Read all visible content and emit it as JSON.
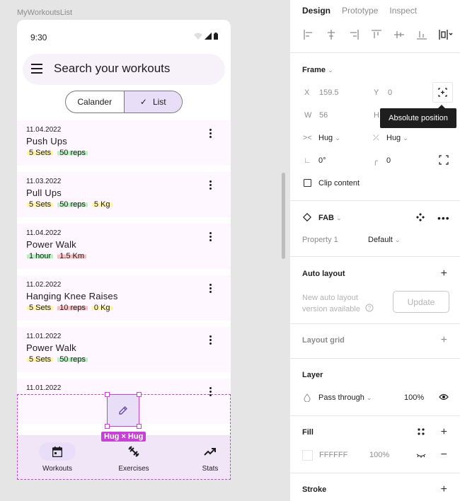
{
  "canvas": {
    "frame_label": "MyWorkoutsList"
  },
  "phone": {
    "time": "9:30",
    "search_placeholder": "Search your workouts",
    "segmented": {
      "option1": "Calander",
      "option2": "List",
      "selected": "List"
    },
    "workouts": [
      {
        "date": "11.04.2022",
        "name": "Push Ups",
        "tags": [
          {
            "text": "5 Sets",
            "color": "yellow"
          },
          {
            "text": "50 reps",
            "color": "green"
          }
        ]
      },
      {
        "date": "11.03.2022",
        "name": "Pull Ups",
        "tags": [
          {
            "text": "5 Sets",
            "color": "yellow"
          },
          {
            "text": "50 reps",
            "color": "green"
          },
          {
            "text": "5 Kg",
            "color": "yellow"
          }
        ]
      },
      {
        "date": "11.04.2022",
        "name": "Power Walk",
        "tags": [
          {
            "text": "1 hour",
            "color": "green"
          },
          {
            "text": "1.5 Km",
            "color": "red"
          }
        ]
      },
      {
        "date": "11.02.2022",
        "name": "Hanging Knee Raises",
        "tags": [
          {
            "text": "5 Sets",
            "color": "yellow"
          },
          {
            "text": "10 reps",
            "color": "red"
          },
          {
            "text": "0 Kg",
            "color": "yellow"
          }
        ]
      },
      {
        "date": "11.01.2022",
        "name": "Power Walk",
        "tags": [
          {
            "text": "5 Sets",
            "color": "yellow"
          },
          {
            "text": "50 reps",
            "color": "green"
          }
        ]
      },
      {
        "date": "11.01.2022",
        "name": "",
        "tags": []
      }
    ],
    "fab_badge": "Hug × Hug",
    "nav": {
      "workouts": "Workouts",
      "exercises": "Exercises",
      "stats": "Stats"
    }
  },
  "panel": {
    "tabs": {
      "design": "Design",
      "prototype": "Prototype",
      "inspect": "Inspect"
    },
    "frame": {
      "title": "Frame",
      "x_label": "X",
      "x_value": "159.5",
      "y_label": "Y",
      "y_value": "0",
      "w_label": "W",
      "w_value": "56",
      "h_label": "H",
      "tooltip": "Absolute position",
      "hug_h": "Hug",
      "hug_v": "Hug",
      "rotation": "0°",
      "radius": "0",
      "clip_content": "Clip content"
    },
    "component": {
      "name": "FAB",
      "property_label": "Property 1",
      "property_value": "Default"
    },
    "auto_layout": {
      "title": "Auto layout",
      "note": "New auto layout version available",
      "update": "Update"
    },
    "layout_grid": {
      "title": "Layout grid"
    },
    "layer": {
      "title": "Layer",
      "blend": "Pass through",
      "opacity": "100%"
    },
    "fill": {
      "title": "Fill",
      "hex": "FFFFFF",
      "opacity": "100%"
    },
    "stroke": {
      "title": "Stroke"
    }
  },
  "colors": {
    "accent": "#c642d4",
    "primary_container": "#e8def8",
    "surface": "#fef7ff"
  }
}
